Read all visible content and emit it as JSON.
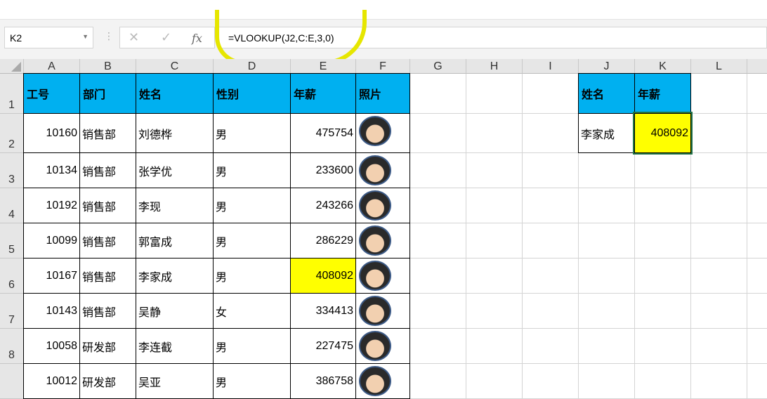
{
  "formula_bar": {
    "name_box": "K2",
    "cancel_icon": "✕",
    "enter_icon": "✓",
    "fx_label": "fx",
    "formula": "=VLOOKUP(J2,C:E,3,0)"
  },
  "columns": [
    "A",
    "B",
    "C",
    "D",
    "E",
    "F",
    "G",
    "H",
    "I",
    "J",
    "K",
    "L"
  ],
  "rows": [
    "1",
    "2",
    "3",
    "4",
    "5",
    "6",
    "7",
    "8",
    ""
  ],
  "headers": [
    "工号",
    "部门",
    "姓名",
    "性别",
    "年薪",
    "照片"
  ],
  "data": [
    [
      "10160",
      "销售部",
      "刘德桦",
      "男",
      "475754"
    ],
    [
      "10134",
      "销售部",
      "张学优",
      "男",
      "233600"
    ],
    [
      "10192",
      "销售部",
      "李现",
      "男",
      "243266"
    ],
    [
      "10099",
      "销售部",
      "郭富成",
      "男",
      "286229"
    ],
    [
      "10167",
      "销售部",
      "李家成",
      "男",
      "408092"
    ],
    [
      "10143",
      "销售部",
      "吴静",
      "女",
      "334413"
    ],
    [
      "10058",
      "研发部",
      "李连截",
      "男",
      "227475"
    ],
    [
      "10012",
      "研发部",
      "吴亚",
      "男",
      "386758"
    ]
  ],
  "lookup": {
    "headers": [
      "姓名",
      "年薪"
    ],
    "name": "李家成",
    "salary": "408092"
  },
  "colors": {
    "header_fill": "#00b0f0",
    "highlight": "#ffff00",
    "annotation": "#e6e600"
  }
}
